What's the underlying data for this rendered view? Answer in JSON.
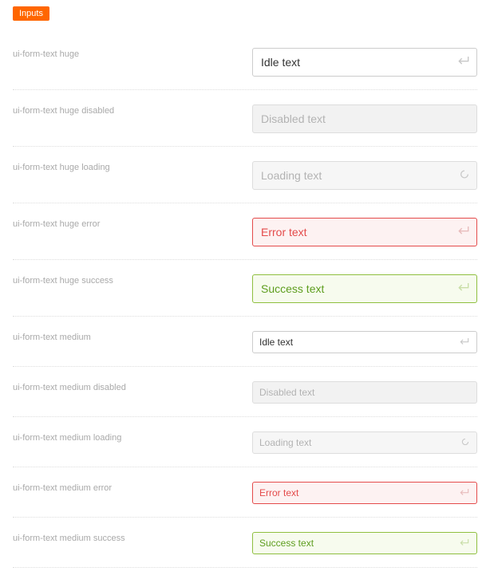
{
  "badge": "Inputs",
  "rows": [
    {
      "label": "ui-form-text huge",
      "value": "Idle text",
      "size": "huge",
      "state": "idle",
      "icon": "enter"
    },
    {
      "label": "ui-form-text huge disabled",
      "placeholder": "Disabled text",
      "size": "huge",
      "state": "disabled",
      "icon": "none"
    },
    {
      "label": "ui-form-text huge loading",
      "placeholder": "Loading text",
      "size": "huge",
      "state": "loading",
      "icon": "spinner"
    },
    {
      "label": "ui-form-text huge error",
      "value": "Error text",
      "size": "huge",
      "state": "error",
      "icon": "enter"
    },
    {
      "label": "ui-form-text huge success",
      "value": "Success text",
      "size": "huge",
      "state": "success",
      "icon": "enter"
    },
    {
      "label": "ui-form-text medium",
      "value": "Idle text",
      "size": "medium",
      "state": "idle",
      "icon": "enter"
    },
    {
      "label": "ui-form-text medium disabled",
      "placeholder": "Disabled text",
      "size": "medium",
      "state": "disabled",
      "icon": "none"
    },
    {
      "label": "ui-form-text medium loading",
      "placeholder": "Loading text",
      "size": "medium",
      "state": "loading",
      "icon": "spinner"
    },
    {
      "label": "ui-form-text medium error",
      "value": "Error text",
      "size": "medium",
      "state": "error",
      "icon": "enter"
    },
    {
      "label": "ui-form-text medium success",
      "value": "Success text",
      "size": "medium",
      "state": "success",
      "icon": "enter"
    }
  ]
}
